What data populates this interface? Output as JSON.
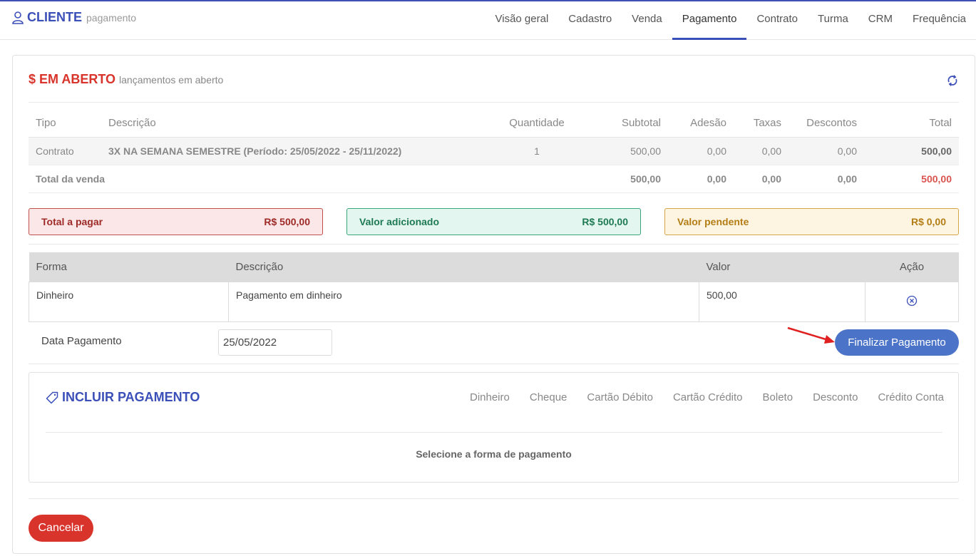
{
  "header": {
    "title": "CLIENTE",
    "subtitle": "pagamento",
    "tabs": [
      {
        "label": "Visão geral"
      },
      {
        "label": "Cadastro"
      },
      {
        "label": "Venda"
      },
      {
        "label": "Pagamento"
      },
      {
        "label": "Contrato"
      },
      {
        "label": "Turma"
      },
      {
        "label": "CRM"
      },
      {
        "label": "Frequência"
      }
    ],
    "active_tab": "Pagamento"
  },
  "section": {
    "title": "$ EM ABERTO",
    "subtitle": "lançamentos em aberto"
  },
  "sales_table": {
    "headers": [
      "Tipo",
      "Descrição",
      "Quantidade",
      "Subtotal",
      "Adesão",
      "Taxas",
      "Descontos",
      "Total"
    ],
    "rows": [
      {
        "tipo": "Contrato",
        "descricao": "3X NA SEMANA SEMESTRE (Período: 25/05/2022 - 25/11/2022)",
        "quantidade": "1",
        "subtotal": "500,00",
        "adesao": "0,00",
        "taxas": "0,00",
        "descontos": "0,00",
        "total": "500,00"
      }
    ],
    "footer": {
      "label": "Total da venda",
      "subtotal": "500,00",
      "adesao": "0,00",
      "taxas": "0,00",
      "descontos": "0,00",
      "total": "500,00"
    }
  },
  "summary": {
    "total_pagar": {
      "label": "Total a pagar",
      "value": "R$ 500,00"
    },
    "valor_adicionado": {
      "label": "Valor adicionado",
      "value": "R$ 500,00"
    },
    "valor_pendente": {
      "label": "Valor pendente",
      "value": "R$ 0,00"
    }
  },
  "payments_table": {
    "headers": [
      "Forma",
      "Descrição",
      "Valor",
      "Ação"
    ],
    "rows": [
      {
        "forma": "Dinheiro",
        "descricao": "Pagamento em dinheiro",
        "valor": "500,00",
        "acao_icon": "remove-circle-icon"
      }
    ]
  },
  "payment_date": {
    "label": "Data Pagamento",
    "value": "25/05/2022"
  },
  "finalize_button": "Finalizar Pagamento",
  "include_payment": {
    "title": "INCLUIR PAGAMENTO",
    "methods": [
      "Dinheiro",
      "Cheque",
      "Cartão Débito",
      "Cartão Crédito",
      "Boleto",
      "Desconto",
      "Crédito Conta"
    ],
    "message": "Selecione a forma de pagamento"
  },
  "cancel_button": "Cancelar",
  "colors": {
    "primary": "#3b4fb8",
    "danger": "#d9342b",
    "button_blue": "#4b74c9",
    "success": "#3aa57b",
    "warning": "#d4a546"
  }
}
